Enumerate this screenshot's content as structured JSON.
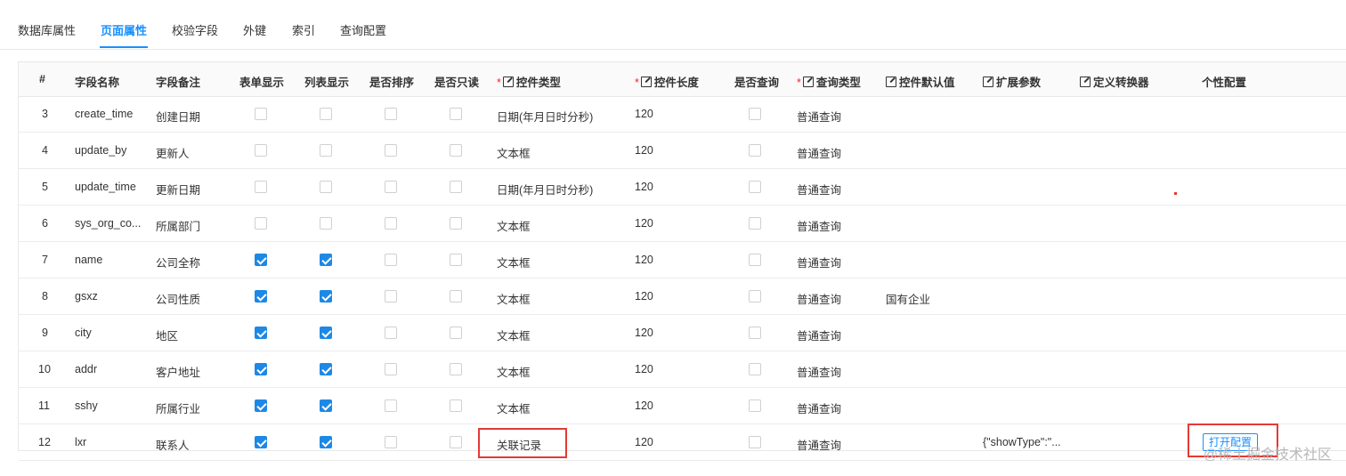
{
  "tabs": [
    {
      "label": "数据库属性",
      "active": false
    },
    {
      "label": "页面属性",
      "active": true
    },
    {
      "label": "校验字段",
      "active": false
    },
    {
      "label": "外键",
      "active": false
    },
    {
      "label": "索引",
      "active": false
    },
    {
      "label": "查询配置",
      "active": false
    }
  ],
  "table": {
    "headers": {
      "index": "#",
      "field_name": "字段名称",
      "field_remark": "字段备注",
      "form_show": "表单显示",
      "list_show": "列表显示",
      "sortable": "是否排序",
      "readonly": "是否只读",
      "control_type": "控件类型",
      "control_length": "控件长度",
      "queryable": "是否查询",
      "query_type": "查询类型",
      "default_value": "控件默认值",
      "ext_params": "扩展参数",
      "converter": "定义转换器",
      "custom_config": "个性配置"
    },
    "required_mark": "*",
    "rows": [
      {
        "index": "3",
        "name": "create_time",
        "remark": "创建日期",
        "form": false,
        "list": false,
        "sort": false,
        "readonly": false,
        "control": "日期(年月日时分秒)",
        "length": "120",
        "query": false,
        "query_type": "普通查询",
        "default": "",
        "ext": ""
      },
      {
        "index": "4",
        "name": "update_by",
        "remark": "更新人",
        "form": false,
        "list": false,
        "sort": false,
        "readonly": false,
        "control": "文本框",
        "length": "120",
        "query": false,
        "query_type": "普通查询",
        "default": "",
        "ext": ""
      },
      {
        "index": "5",
        "name": "update_time",
        "remark": "更新日期",
        "form": false,
        "list": false,
        "sort": false,
        "readonly": false,
        "control": "日期(年月日时分秒)",
        "length": "120",
        "query": false,
        "query_type": "普通查询",
        "default": "",
        "ext": ""
      },
      {
        "index": "6",
        "name": "sys_org_co...",
        "remark": "所属部门",
        "form": false,
        "list": false,
        "sort": false,
        "readonly": false,
        "control": "文本框",
        "length": "120",
        "query": false,
        "query_type": "普通查询",
        "default": "",
        "ext": ""
      },
      {
        "index": "7",
        "name": "name",
        "remark": "公司全称",
        "form": true,
        "list": true,
        "sort": false,
        "readonly": false,
        "control": "文本框",
        "length": "120",
        "query": false,
        "query_type": "普通查询",
        "default": "",
        "ext": ""
      },
      {
        "index": "8",
        "name": "gsxz",
        "remark": "公司性质",
        "form": true,
        "list": true,
        "sort": false,
        "readonly": false,
        "control": "文本框",
        "length": "120",
        "query": false,
        "query_type": "普通查询",
        "default": "国有企业",
        "ext": ""
      },
      {
        "index": "9",
        "name": "city",
        "remark": "地区",
        "form": true,
        "list": true,
        "sort": false,
        "readonly": false,
        "control": "文本框",
        "length": "120",
        "query": false,
        "query_type": "普通查询",
        "default": "",
        "ext": ""
      },
      {
        "index": "10",
        "name": "addr",
        "remark": "客户地址",
        "form": true,
        "list": true,
        "sort": false,
        "readonly": false,
        "control": "文本框",
        "length": "120",
        "query": false,
        "query_type": "普通查询",
        "default": "",
        "ext": ""
      },
      {
        "index": "11",
        "name": "sshy",
        "remark": "所属行业",
        "form": true,
        "list": true,
        "sort": false,
        "readonly": false,
        "control": "文本框",
        "length": "120",
        "query": false,
        "query_type": "普通查询",
        "default": "",
        "ext": ""
      },
      {
        "index": "12",
        "name": "lxr",
        "remark": "联系人",
        "form": true,
        "list": true,
        "sort": false,
        "readonly": false,
        "control": "关联记录",
        "length": "120",
        "query": false,
        "query_type": "普通查询",
        "default": "",
        "ext": "{\"showType\":\"...",
        "config_button": "打开配置"
      }
    ]
  },
  "watermark": "@稀土掘金技术社区",
  "colors": {
    "accent": "#1890ff",
    "checked": "#1e88e5",
    "highlight": "#e53935",
    "required": "#f5222d"
  }
}
